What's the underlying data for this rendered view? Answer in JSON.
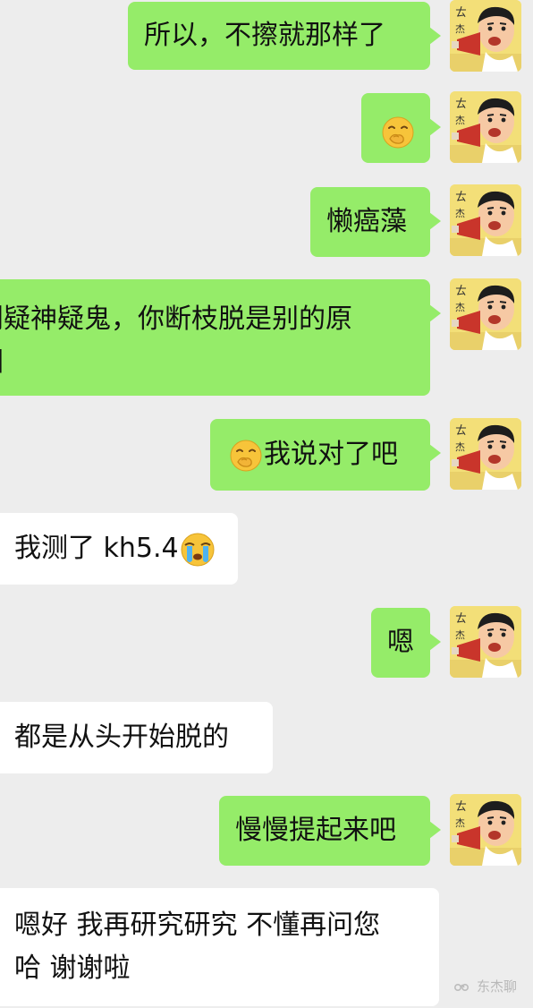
{
  "messages": [
    {
      "side": "out",
      "text": "所以，不擦就那样了"
    },
    {
      "side": "out",
      "emoji": "hand-over-mouth-emoji"
    },
    {
      "side": "out",
      "text": "懒癌藻"
    },
    {
      "side": "out",
      "line1": "别疑神疑鬼，你断枝脱是别的原",
      "line2": "因"
    },
    {
      "side": "out",
      "emoji": "hand-over-mouth-emoji",
      "text": "我说对了吧"
    },
    {
      "side": "in",
      "text": "我测了 kh5.4",
      "emoji": "crying-face-emoji"
    },
    {
      "side": "out",
      "text": "嗯"
    },
    {
      "side": "in",
      "text": "都是从头开始脱的"
    },
    {
      "side": "out",
      "text": "慢慢提起来吧"
    },
    {
      "side": "in",
      "line1": "嗯好 我再研究研究 不懂再问您",
      "line2": "哈 谢谢啦"
    }
  ],
  "watermark": {
    "text": "东杰聊",
    "icon": "wechat-channel-icon"
  },
  "colors": {
    "background": "#ededed",
    "outgoing_bubble": "#95ec69",
    "incoming_bubble": "#ffffff"
  }
}
